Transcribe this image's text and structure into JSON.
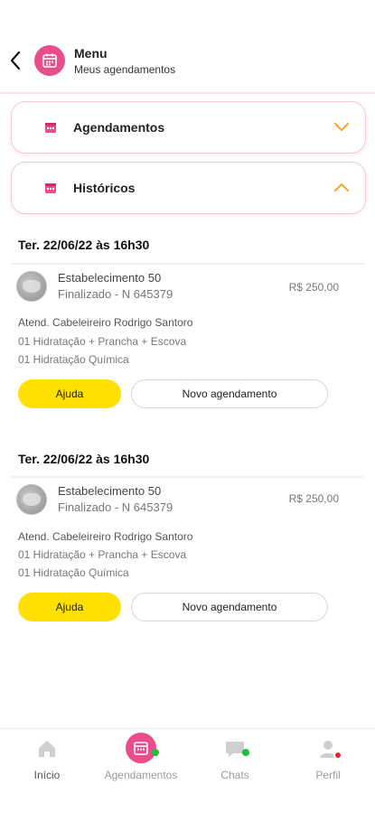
{
  "header": {
    "title": "Menu",
    "subtitle": "Meus agendamentos",
    "back_icon": "chevron-left-icon",
    "menu_icon": "calendar-icon"
  },
  "accordions": [
    {
      "label": "Agendamentos",
      "icon": "calendar-icon",
      "state": "collapsed",
      "chevron": "chevron-down-icon"
    },
    {
      "label": "Históricos",
      "icon": "calendar-icon",
      "state": "expanded",
      "chevron": "chevron-up-icon"
    }
  ],
  "history": [
    {
      "date": "Ter. 22/06/22 às 16h30",
      "establishment": "Estabelecimento 50",
      "status": "Finalizado - N 645379",
      "price": "R$ 250,00",
      "attendant": "Atend. Cabeleireiro Rodrigo Santoro",
      "services": [
        "01 Hidratação + Prancha + Escova",
        "01 Hidratação Química"
      ],
      "help_label": "Ajuda",
      "new_label": "Novo agendamento"
    },
    {
      "date": "Ter. 22/06/22 às 16h30",
      "establishment": "Estabelecimento 50",
      "status": "Finalizado - N 645379",
      "price": "R$ 250,00",
      "attendant": "Atend. Cabeleireiro Rodrigo Santoro",
      "services": [
        "01 Hidratação + Prancha + Escova",
        "01 Hidratação Química"
      ],
      "help_label": "Ajuda",
      "new_label": "Novo agendamento"
    }
  ],
  "nav": [
    {
      "label": "Início",
      "icon": "home-icon"
    },
    {
      "label": "Agendamentos",
      "icon": "calendar-icon",
      "active": true
    },
    {
      "label": "Chats",
      "icon": "chat-icon"
    },
    {
      "label": "Perfil",
      "icon": "user-icon"
    }
  ],
  "colors": {
    "accent_pink": "#ea4d8b",
    "accent_yellow": "#ffe000",
    "chevron_orange": "#f5a623",
    "online_green": "#1fbf3a",
    "alert_red": "#e5252a"
  }
}
